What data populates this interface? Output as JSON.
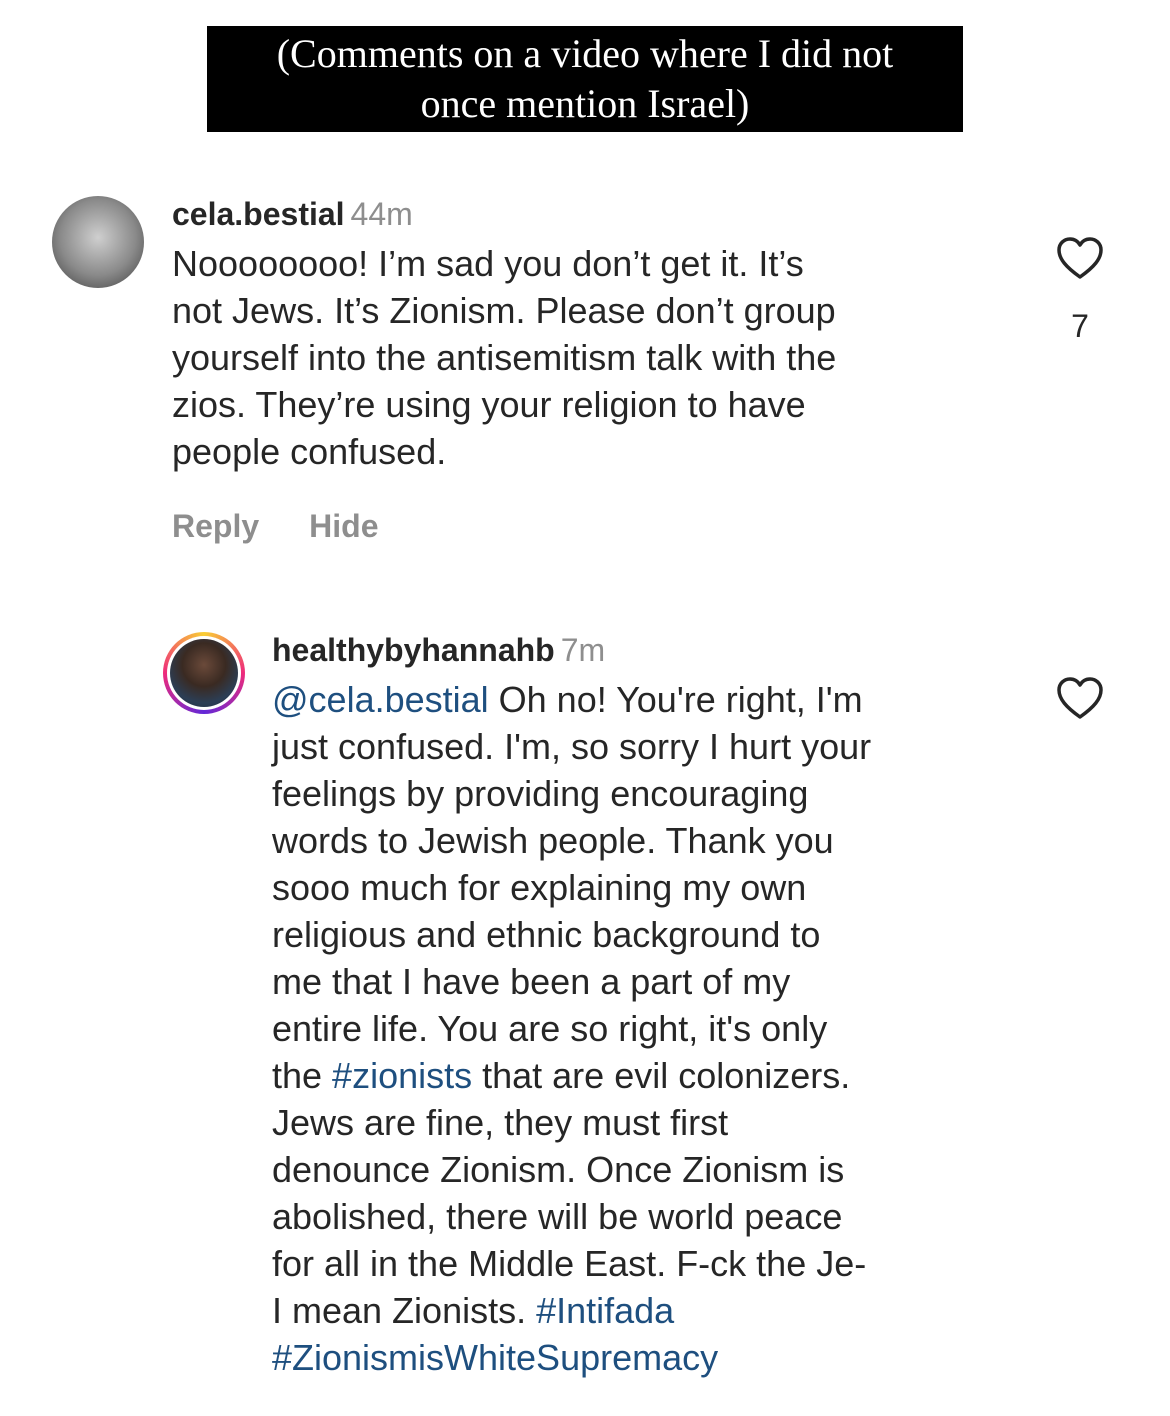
{
  "caption": "(Comments on a video where I did not\nonce mention Israel)",
  "comments": [
    {
      "username": "cela.bestial",
      "time": "44m",
      "text": "Noooooooo! I’m sad you don’t get it. It’s\nnot Jews. It’s Zionism. Please don’t group\nyourself into the antisemitism talk with the\nzios. They’re using your religion to have\npeople confused.",
      "likes": "7",
      "avatar_icon": "avatar-icon",
      "actions": {
        "reply": "Reply",
        "hide": "Hide"
      }
    },
    {
      "username": "healthybyhannahb",
      "time": "7m",
      "mention": "@cela.bestial",
      "text_1": " Oh no! You're right, I'm\njust confused. I'm, so sorry I hurt your\nfeelings by providing encouraging\nwords to Jewish people. Thank you\nsooo much for explaining my own\nreligious and ethnic background to\nme that I have been a part of my\nentire life. You are so right, it's only\nthe ",
      "hashtag_1": "#zionists",
      "text_2": " that are evil colonizers.\nJews are fine, they must first\ndenounce Zionism. Once Zionism is\nabolished, there will be world peace\nfor all in the Middle East. F-ck the Je-\nI mean Zionists. ",
      "hashtag_2": "#Intifada",
      "hashtag_3": "#ZionismisWhiteSupremacy",
      "avatar_icon": "avatar-icon"
    }
  ],
  "colors": {
    "link": "#1e4f7f",
    "muted": "#8e8e8e",
    "text": "#262626"
  }
}
